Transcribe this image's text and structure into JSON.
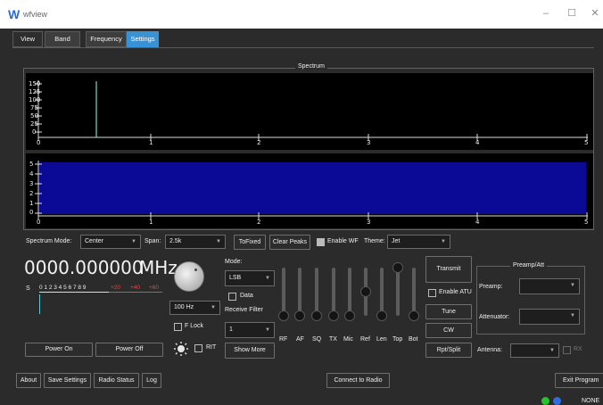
{
  "window": {
    "title": "wfview",
    "logo": "W",
    "controls": [
      "–",
      "☐",
      "✕"
    ]
  },
  "tabs": [
    "View",
    "Band",
    "Frequency",
    "Settings"
  ],
  "spectrum": {
    "title": "Spectrum",
    "y_ticks": [
      "150",
      "125",
      "100",
      "75",
      "50",
      "25",
      "0"
    ],
    "x_ticks": [
      "0",
      "1",
      "2",
      "3",
      "4",
      "5"
    ],
    "waterfall_y_ticks": [
      "5",
      "4",
      "3",
      "2",
      "1",
      "0"
    ]
  },
  "controls_row": {
    "spectrum_mode_label": "Spectrum Mode:",
    "spectrum_mode_value": "Center",
    "span_label": "Span:",
    "span_value": "2.5k",
    "tofixed_label": "ToFixed",
    "clear_peaks_label": "Clear Peaks",
    "enable_wf_label": "Enable WF",
    "theme_label": "Theme:",
    "theme_value": "Jet"
  },
  "frequency": {
    "value": "0000.000000",
    "unit": "MHz",
    "s_meter_label": "S",
    "s_scale": "0 1 2 3 4 5 6 7 8 9",
    "s_plus": [
      "+20",
      "+40",
      "+60"
    ],
    "step_value": "100 Hz",
    "flock_label": "F Lock",
    "rit_label": "RIT"
  },
  "power": {
    "on_label": "Power On",
    "off_label": "Power Off"
  },
  "mode": {
    "mode_label": "Mode:",
    "mode_value": "LSB",
    "data_label": "Data",
    "receive_filter_label": "Receive Filter",
    "filter_value": "1",
    "show_more_label": "Show More"
  },
  "sliders": {
    "labels": [
      "RF",
      "AF",
      "SQ",
      "TX",
      "Mic",
      "Ref",
      "Len",
      "Top",
      "Bot"
    ],
    "levels": [
      0.0,
      0.0,
      0.0,
      0.0,
      0.0,
      0.5,
      0.0,
      1.0,
      0.0
    ]
  },
  "tx": {
    "transmit_label": "Transmit",
    "enable_atu_label": "Enable ATU",
    "tune_label": "Tune",
    "cw_label": "CW",
    "rpt_split_label": "Rpt/Split"
  },
  "preamp": {
    "title": "Preamp/Att",
    "preamp_label": "Preamp:",
    "attenuator_label": "Attenuator:",
    "antenna_label": "Antenna:",
    "rx_label": "RX"
  },
  "bottom_bar": {
    "about_label": "About",
    "save_settings_label": "Save Settings",
    "radio_status_label": "Radio Status",
    "log_label": "Log",
    "connect_label": "Connect to Radio",
    "exit_label": "Exit Program"
  },
  "status": {
    "text": "NONE"
  },
  "colors": {
    "accent": "#3a92d6",
    "waterfall": "#0a0a96",
    "spectrum_line": "#7ad7c8"
  }
}
